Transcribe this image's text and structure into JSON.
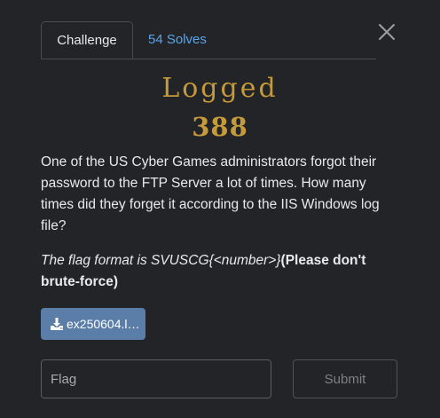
{
  "tabs": {
    "challenge_label": "Challenge",
    "solves_label": "54 Solves"
  },
  "challenge": {
    "name": "Logged",
    "value": "388",
    "description": "One of the US Cyber Games administrators forgot their password to the FTP Server a lot of times. How many times did they forget it according to the IIS Windows log file?",
    "flag_format_prefix": "The flag format is SVUSCG{<number>}",
    "flag_format_note": "(Please don't brute-force)"
  },
  "files": [
    {
      "name": "ex250604.l…"
    }
  ],
  "submission": {
    "placeholder": "Flag",
    "submit_label": "Submit"
  },
  "colors": {
    "background": "#222428",
    "accent_title": "#c59a3a",
    "link": "#5aa5ea",
    "file_button": "#5b7ea8"
  },
  "icons": {
    "close": "close-icon",
    "download": "download-icon"
  }
}
